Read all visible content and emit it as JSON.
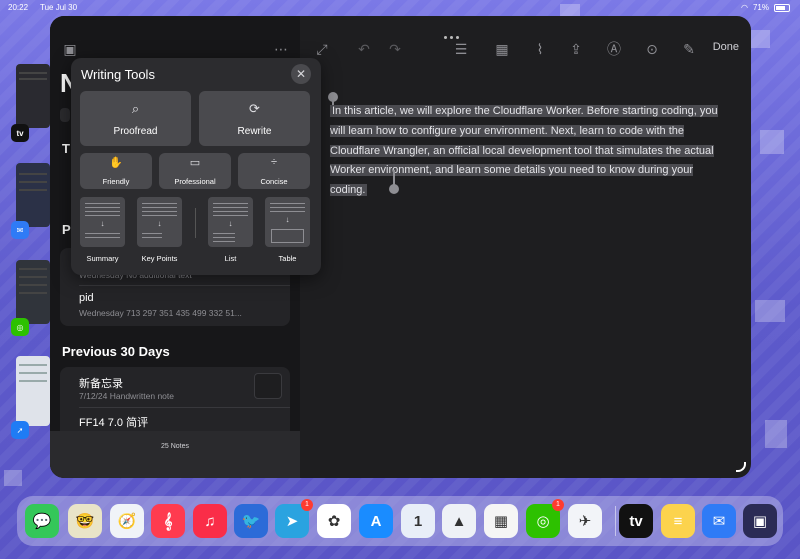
{
  "status": {
    "time": "20:22",
    "date": "Tue Jul 30",
    "battery": "71%"
  },
  "toolbar": {
    "done_label": "Done"
  },
  "sidebar": {
    "partial_letters": {
      "big": "N",
      "t": "T",
      "p": "P"
    },
    "pinned_notes": [
      {
        "title": "",
        "subtitle": "Wednesday  No additional text"
      },
      {
        "title": "pid",
        "subtitle": "Wednesday  713 297 351 435 499 332 51..."
      }
    ],
    "section_previous": "Previous 30 Days",
    "previous_notes": [
      {
        "title": "新备忘录",
        "subtitle": "7/12/24  Handwritten note"
      },
      {
        "title": "FF14 7.0 简评",
        "subtitle": ""
      }
    ],
    "note_count": "25 Notes"
  },
  "editor": {
    "selected_text": "In this article, we will explore the Cloudflare Worker. Before starting coding, you will learn how to configure your environment. Next, learn to code with the Cloudflare Wrangler, an official local development tool that simulates the actual Worker environment, and learn some details you need to know during your coding."
  },
  "writing_tools": {
    "title": "Writing Tools",
    "primary": [
      {
        "label": "Proofread",
        "icon": "magnifier-icon"
      },
      {
        "label": "Rewrite",
        "icon": "rewrite-icon"
      }
    ],
    "tones": [
      {
        "label": "Friendly",
        "icon": "hand-icon"
      },
      {
        "label": "Professional",
        "icon": "briefcase-icon"
      },
      {
        "label": "Concise",
        "icon": "divide-icon"
      }
    ],
    "transforms": [
      {
        "label": "Summary"
      },
      {
        "label": "Key Points"
      },
      {
        "label": "List"
      },
      {
        "label": "Table"
      }
    ]
  },
  "dock": {
    "apps": [
      {
        "name": "Messages",
        "color": "#34c759",
        "glyph": "💬"
      },
      {
        "name": "Memoji",
        "color": "#e9e4c8",
        "glyph": "🤓"
      },
      {
        "name": "Safari",
        "color": "#f0f3f8",
        "glyph": "🧭"
      },
      {
        "name": "Music Creator",
        "color": "#ff3b4f",
        "glyph": "𝄞"
      },
      {
        "name": "Music",
        "color": "#fa2d48",
        "glyph": "♫"
      },
      {
        "name": "Game",
        "color": "#2c6bd8",
        "glyph": "🐦"
      },
      {
        "name": "Telegram",
        "color": "#2aa3e0",
        "glyph": "➤",
        "badge": "1"
      },
      {
        "name": "Photos",
        "color": "#ffffff",
        "glyph": "✿"
      },
      {
        "name": "App Store",
        "color": "#1a8cff",
        "glyph": "A"
      },
      {
        "name": "1Password",
        "color": "#e8eef8",
        "glyph": "1"
      },
      {
        "name": "Spark",
        "color": "#eef1f6",
        "glyph": "▲"
      },
      {
        "name": "Fantastical",
        "color": "#f5f5f5",
        "glyph": "▦"
      },
      {
        "name": "WeChat",
        "color": "#2dc100",
        "glyph": "◎",
        "badge": "1"
      },
      {
        "name": "Airline",
        "color": "#f2f4f8",
        "glyph": "✈"
      },
      {
        "name": "Apple TV",
        "color": "#111111",
        "glyph": "tv"
      },
      {
        "name": "Notes",
        "color": "#fcd34d",
        "glyph": "≡"
      },
      {
        "name": "Mail",
        "color": "#2f7bf6",
        "glyph": "✉"
      },
      {
        "name": "App Library",
        "color": "#2b2b55",
        "glyph": "▣"
      }
    ]
  }
}
